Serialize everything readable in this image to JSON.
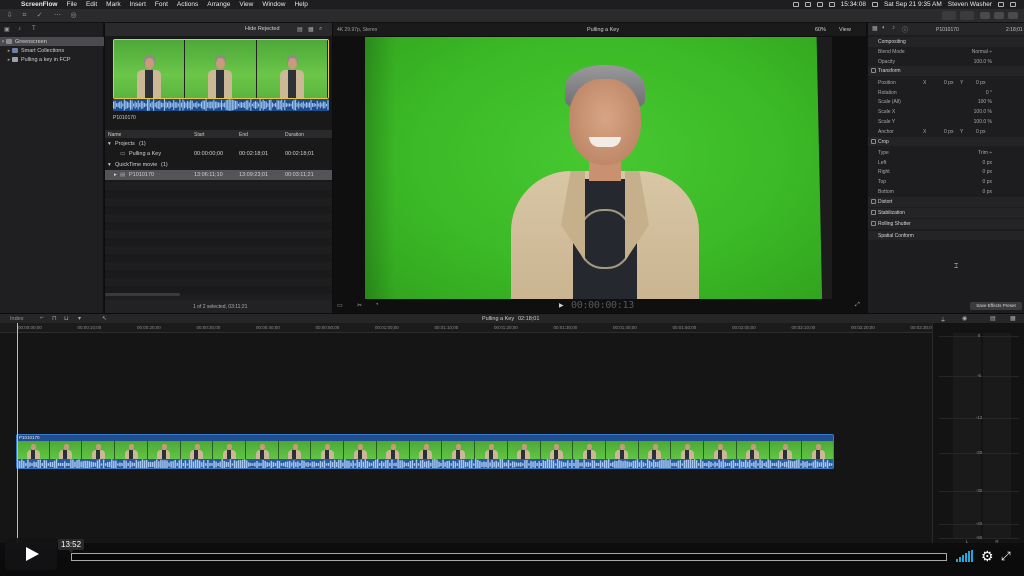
{
  "menubar": {
    "apple": "",
    "app_name": "ScreenFlow",
    "items": [
      "File",
      "Edit",
      "Mark",
      "Insert",
      "Font",
      "Actions",
      "Arrange",
      "View",
      "Window",
      "Help"
    ],
    "clock": "Sat Sep 21  9:35 AM",
    "user": "Steven Washer",
    "battery_time": "15:34:08"
  },
  "browser": {
    "hide_rejected": "Hide Rejected",
    "clip_name": "P1010170",
    "columns": [
      "Name",
      "Start",
      "End",
      "Duration"
    ],
    "rows": [
      {
        "type": "group",
        "name": "Projects",
        "count": "(1)"
      },
      {
        "type": "item",
        "name": "Pulling a Key",
        "start": "00:00:00;00",
        "end": "00:02:18;01",
        "duration": "00:02:18;01"
      },
      {
        "type": "group",
        "name": "QuickTime movie",
        "count": "(1)"
      },
      {
        "type": "item",
        "name": "P1010170",
        "start": "13:06:11;10",
        "end": "13:09:23;01",
        "duration": "00:03:11;21"
      }
    ],
    "status": "1 of 2 selected, 03:11;21"
  },
  "sidebar": {
    "items": [
      {
        "label": "Greenscreen",
        "level": 0
      },
      {
        "label": "Smart Collections",
        "level": 1
      },
      {
        "label": "Pulling a key in FCP",
        "level": 1
      }
    ]
  },
  "viewer": {
    "format": "4K 29.97p, Stereo",
    "title": "Pulling a Key",
    "zoom": "60%",
    "view_menu": "View",
    "timecode": "00:00:00:13"
  },
  "inspector": {
    "clip_name": "P1010170",
    "clip_duration": "2:18;01",
    "rows": [
      {
        "kind": "section-plain",
        "label": "Compositing"
      },
      {
        "kind": "param",
        "label": "Blend Mode",
        "value": "Normal ÷"
      },
      {
        "kind": "param",
        "label": "Opacity",
        "value": "100.0  %"
      },
      {
        "kind": "section",
        "label": "Transform"
      },
      {
        "kind": "param",
        "label": "Position",
        "x": "0 px",
        "y": "0 px"
      },
      {
        "kind": "param",
        "label": "Rotation",
        "value": "0 °"
      },
      {
        "kind": "param",
        "label": "Scale (All)",
        "value": "100 %"
      },
      {
        "kind": "param",
        "label": "Scale X",
        "value": "100.0 %"
      },
      {
        "kind": "param",
        "label": "Scale Y",
        "value": "100.0 %"
      },
      {
        "kind": "param",
        "label": "Anchor",
        "x": "0 px",
        "y": "0 px"
      },
      {
        "kind": "section",
        "label": "Crop"
      },
      {
        "kind": "param",
        "label": "Type",
        "value": "Trim ÷"
      },
      {
        "kind": "param",
        "label": "Left",
        "value": "0 px"
      },
      {
        "kind": "param",
        "label": "Right",
        "value": "0 px"
      },
      {
        "kind": "param",
        "label": "Top",
        "value": "0 px"
      },
      {
        "kind": "param",
        "label": "Bottom",
        "value": "0 px"
      },
      {
        "kind": "section",
        "label": "Distort"
      },
      {
        "kind": "section",
        "label": "Stabilization"
      },
      {
        "kind": "section",
        "label": "Rolling Shutter"
      },
      {
        "kind": "section-plain",
        "label": "Spatial Conform"
      }
    ],
    "save_preset": "Save Effects Preset"
  },
  "timeline": {
    "index_label": "Index",
    "title": "Pulling a Key",
    "duration": "02:18;01",
    "ruler": [
      "00:00:00;00",
      "00:00:10;00",
      "00:00:20;00",
      "00:00:30;00",
      "00:00:40;00",
      "00:00:50;00",
      "00:01:00;00",
      "00:01:10;00",
      "00:01:20;00",
      "00:01:30;00",
      "00:01:40;00",
      "00:01:50;00",
      "00:02:00;00",
      "00:02:10;00",
      "00:02:20;00",
      "00:02:30;00",
      "00:02:40;00",
      "00:02:50;00"
    ],
    "clip_label": "P1010170",
    "meter_scale": [
      "0",
      "-6",
      "-12",
      "-20",
      "-30",
      "-40",
      "-50"
    ],
    "meter_channels": [
      "L",
      "R"
    ]
  },
  "player": {
    "time": "13:52",
    "progress": 0.0
  }
}
